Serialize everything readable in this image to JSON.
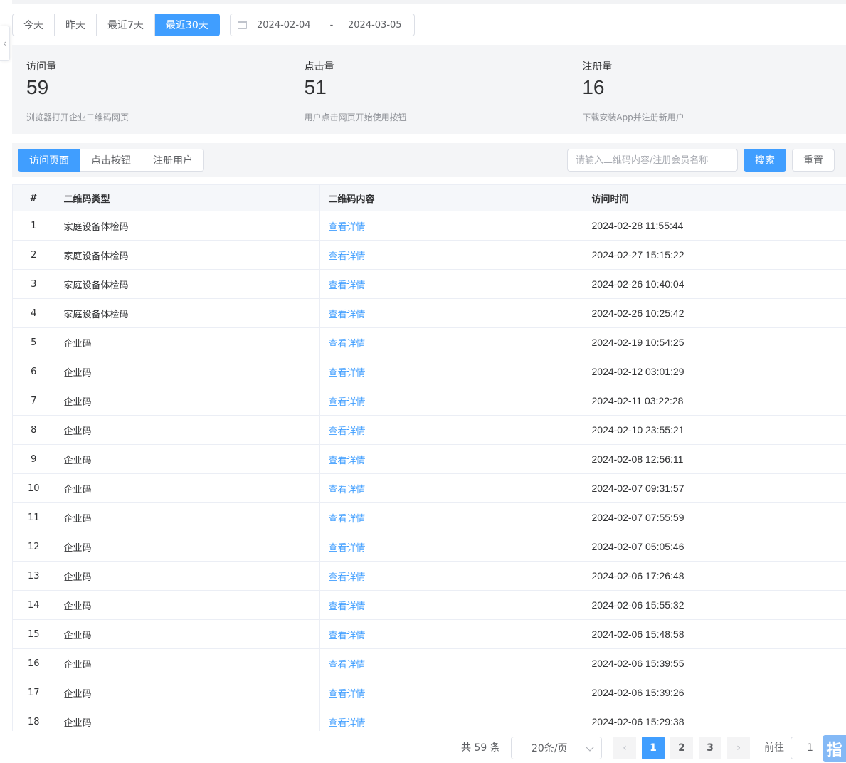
{
  "date_filter": {
    "buttons": [
      "今天",
      "昨天",
      "最近7天",
      "最近30天"
    ],
    "active_index": 3,
    "range_start": "2024-02-04",
    "range_separator": "-",
    "range_end": "2024-03-05"
  },
  "stats": [
    {
      "label": "访问量",
      "value": "59",
      "desc": "浏览器打开企业二维码网页"
    },
    {
      "label": "点击量",
      "value": "51",
      "desc": "用户点击网页开始使用按钮"
    },
    {
      "label": "注册量",
      "value": "16",
      "desc": "下载安装App并注册新用户"
    }
  ],
  "tabs": {
    "items": [
      "访问页面",
      "点击按钮",
      "注册用户"
    ],
    "active_index": 0
  },
  "search": {
    "placeholder": "请输入二维码内容/注册会员名称",
    "search_label": "搜索",
    "reset_label": "重置"
  },
  "table": {
    "headers": [
      "#",
      "二维码类型",
      "二维码内容",
      "访问时间"
    ],
    "rows": [
      {
        "idx": "1",
        "type": "家庭设备体检码",
        "content": "查看详情",
        "time": "2024-02-28 11:55:44"
      },
      {
        "idx": "2",
        "type": "家庭设备体检码",
        "content": "查看详情",
        "time": "2024-02-27 15:15:22"
      },
      {
        "idx": "3",
        "type": "家庭设备体检码",
        "content": "查看详情",
        "time": "2024-02-26 10:40:04"
      },
      {
        "idx": "4",
        "type": "家庭设备体检码",
        "content": "查看详情",
        "time": "2024-02-26 10:25:42"
      },
      {
        "idx": "5",
        "type": "企业码",
        "content": "查看详情",
        "time": "2024-02-19 10:54:25"
      },
      {
        "idx": "6",
        "type": "企业码",
        "content": "查看详情",
        "time": "2024-02-12 03:01:29"
      },
      {
        "idx": "7",
        "type": "企业码",
        "content": "查看详情",
        "time": "2024-02-11 03:22:28"
      },
      {
        "idx": "8",
        "type": "企业码",
        "content": "查看详情",
        "time": "2024-02-10 23:55:21"
      },
      {
        "idx": "9",
        "type": "企业码",
        "content": "查看详情",
        "time": "2024-02-08 12:56:11"
      },
      {
        "idx": "10",
        "type": "企业码",
        "content": "查看详情",
        "time": "2024-02-07 09:31:57"
      },
      {
        "idx": "11",
        "type": "企业码",
        "content": "查看详情",
        "time": "2024-02-07 07:55:59"
      },
      {
        "idx": "12",
        "type": "企业码",
        "content": "查看详情",
        "time": "2024-02-07 05:05:46"
      },
      {
        "idx": "13",
        "type": "企业码",
        "content": "查看详情",
        "time": "2024-02-06 17:26:48"
      },
      {
        "idx": "14",
        "type": "企业码",
        "content": "查看详情",
        "time": "2024-02-06 15:55:32"
      },
      {
        "idx": "15",
        "type": "企业码",
        "content": "查看详情",
        "time": "2024-02-06 15:48:58"
      },
      {
        "idx": "16",
        "type": "企业码",
        "content": "查看详情",
        "time": "2024-02-06 15:39:55"
      },
      {
        "idx": "17",
        "type": "企业码",
        "content": "查看详情",
        "time": "2024-02-06 15:39:26"
      },
      {
        "idx": "18",
        "type": "企业码",
        "content": "查看详情",
        "time": "2024-02-06 15:29:38"
      }
    ]
  },
  "pagination": {
    "total_text": "共 59 条",
    "page_size": "20条/页",
    "pages": [
      "1",
      "2",
      "3"
    ],
    "current_page": "1",
    "goto_label": "前往",
    "goto_value": "1"
  },
  "float_badge": "指",
  "icons": {
    "collapse": "chevron-left-icon",
    "calendar": "calendar-icon",
    "select": "chevron-down-icon",
    "prev": "chevron-left-icon",
    "next": "chevron-right-icon"
  },
  "colors": {
    "primary": "#409eff",
    "panel_bg": "#f4f5f7",
    "border": "#dcdfe6",
    "text": "#303133",
    "muted": "#909399"
  }
}
